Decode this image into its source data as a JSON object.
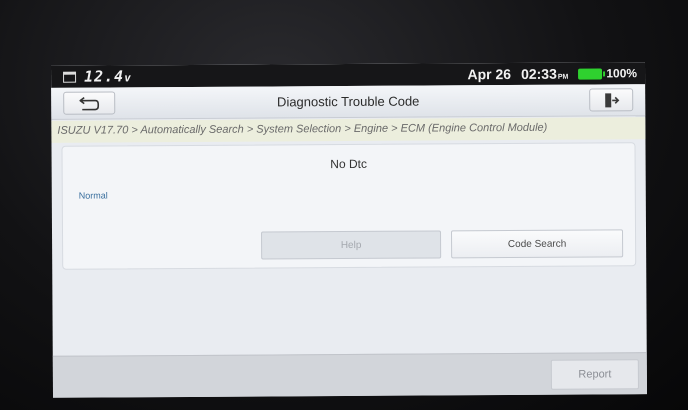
{
  "status_bar": {
    "voltage": "12.4",
    "voltage_unit": "v",
    "date": "Apr 26",
    "time": "02:33",
    "ampm": "PM",
    "battery_percent": "100%",
    "battery_level": 1.0
  },
  "header": {
    "title": "Diagnostic Trouble Code",
    "back_icon": "return-arrow-icon",
    "exit_icon": "exit-door-icon"
  },
  "breadcrumb": "ISUZU V17.70 > Automatically Search > System Selection > Engine > ECM (Engine Control Module)",
  "result": {
    "message": "No Dtc",
    "status": "Normal"
  },
  "buttons": {
    "help": "Help",
    "code_search": "Code Search",
    "report": "Report"
  },
  "colors": {
    "battery": "#2fd12f",
    "status_text": "#3a6f9e"
  }
}
